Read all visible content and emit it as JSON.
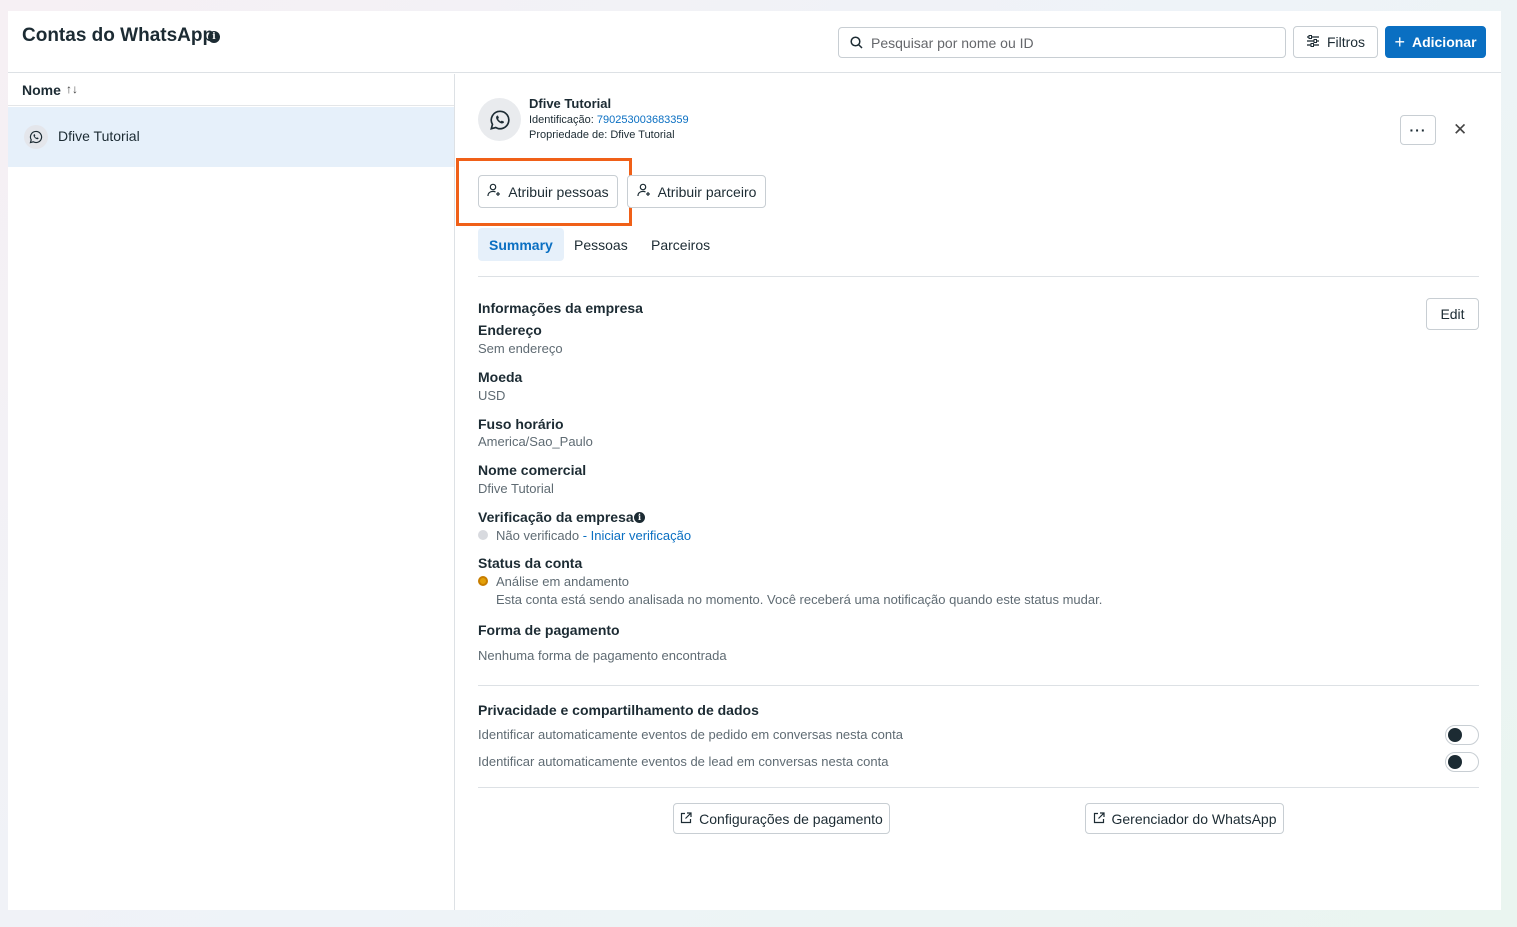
{
  "header": {
    "title": "Contas do WhatsApp",
    "search_placeholder": "Pesquisar por nome ou ID",
    "filters_label": "Filtros",
    "add_label": "Adicionar"
  },
  "list": {
    "column_label": "Nome",
    "sort_symbol": "↑↓",
    "items": [
      {
        "name": "Dfive Tutorial"
      }
    ]
  },
  "account": {
    "name": "Dfive Tutorial",
    "id_label": "Identificação:",
    "id_value": "790253003683359",
    "owner_text": "Propriedade de: Dfive Tutorial",
    "more_label": "···",
    "close_label": "✕"
  },
  "actions": {
    "assign_people": "Atribuir pessoas",
    "assign_partner": "Atribuir parceiro"
  },
  "tabs": [
    {
      "label": "Summary",
      "active": true
    },
    {
      "label": "Pessoas",
      "active": false
    },
    {
      "label": "Parceiros",
      "active": false
    }
  ],
  "company": {
    "section_title": "Informações da empresa",
    "edit_label": "Edit",
    "address_label": "Endereço",
    "address_value": "Sem endereço",
    "currency_label": "Moeda",
    "currency_value": "USD",
    "timezone_label": "Fuso horário",
    "timezone_value": "America/Sao_Paulo",
    "trade_name_label": "Nome comercial",
    "trade_name_value": "Dfive Tutorial",
    "verification_label": "Verificação da empresa",
    "verification_status": "Não verificado",
    "verification_link": "- Iniciar verificação",
    "account_status_label": "Status da conta",
    "account_status_value": "Análise em andamento",
    "account_status_note": "Esta conta está sendo analisada no momento. Você receberá uma notificação quando este status mudar.",
    "payment_label": "Forma de pagamento",
    "payment_value": "Nenhuma forma de pagamento encontrada"
  },
  "privacy": {
    "section_title": "Privacidade e compartilhamento de dados",
    "toggle_orders_label": "Identificar automaticamente eventos de pedido em conversas nesta conta",
    "toggle_orders_on": false,
    "toggle_leads_label": "Identificar automaticamente eventos de lead em conversas nesta conta",
    "toggle_leads_on": false
  },
  "footer": {
    "payment_settings": "Configurações de pagamento",
    "whatsapp_manager": "Gerenciador do WhatsApp"
  },
  "colors": {
    "accent": "#0a6fc2",
    "highlight_box": "#f06018",
    "status_pending": "#e3a008",
    "status_unverified": "#d8dadf"
  }
}
